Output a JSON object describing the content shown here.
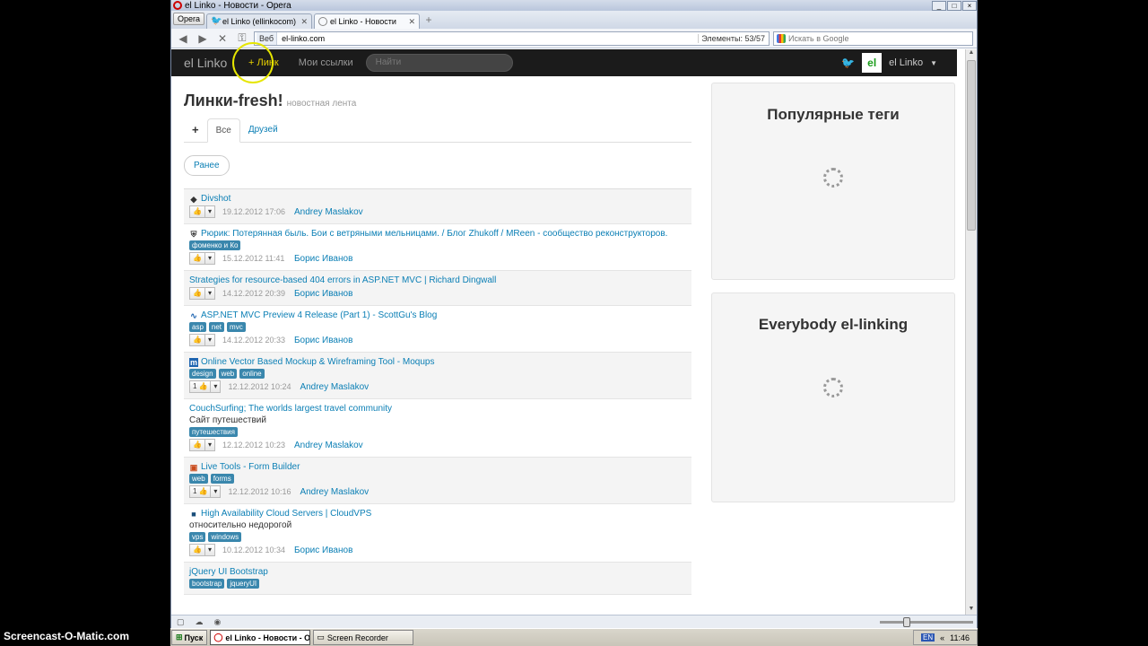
{
  "browser": {
    "window_title": "el Linko - Новости - Opera",
    "menu_label": "Opera",
    "tabs": [
      {
        "label": "el Linko (ellinkocom) в Tw...",
        "icon": "twitter-bird-icon",
        "active": false
      },
      {
        "label": "el Linko - Новости",
        "icon": "loading-icon",
        "active": true
      }
    ],
    "web_label": "Веб",
    "url": "el-linko.com",
    "elements_label": "Элементы:",
    "elements_count": "53/57",
    "search_placeholder": "Искать в Google"
  },
  "site": {
    "brand": "el Linko",
    "add_link": "+ Линк",
    "my_links": "Мои ссылки",
    "search_placeholder": "Найти",
    "avatar_text": "el",
    "username": "el Linko"
  },
  "page": {
    "title": "Линки-fresh!",
    "subtitle": "новостная лента",
    "tabs": {
      "plus": "+",
      "all": "Все",
      "friends": "Друзей"
    },
    "earlier": "Ранее"
  },
  "feed": [
    {
      "icon": "divshot-icon",
      "title": "Divshot",
      "desc": "",
      "tags": [],
      "count": "",
      "date": "19.12.2012 17:06",
      "author": "Andrey Maslakov"
    },
    {
      "icon": "shield-icon",
      "title": "Рюрик: Потерянная быль. Бои с ветряными мельницами. / Блог Zhukoff / MReen - сообщество реконструкторов.",
      "desc": "",
      "tags": [
        "фоменко и Ко"
      ],
      "count": "",
      "date": "15.12.2012 11:41",
      "author": "Борис Иванов"
    },
    {
      "icon": "",
      "title": "Strategies for resource-based 404 errors in ASP.NET MVC | Richard Dingwall",
      "desc": "",
      "tags": [],
      "count": "",
      "date": "14.12.2012 20:39",
      "author": "Борис Иванов"
    },
    {
      "icon": "scottgu-icon",
      "title": "ASP.NET MVC Preview 4 Release (Part 1) - ScottGu's Blog",
      "desc": "",
      "tags": [
        "asp",
        "net",
        "mvc"
      ],
      "count": "",
      "date": "14.12.2012 20:33",
      "author": "Борис Иванов"
    },
    {
      "icon": "moqups-icon",
      "title": "Online Vector Based Mockup & Wireframing Tool - Moqups",
      "desc": "",
      "tags": [
        "design",
        "web",
        "online"
      ],
      "count": "1",
      "date": "12.12.2012 10:24",
      "author": "Andrey Maslakov"
    },
    {
      "icon": "",
      "title": "CouchSurfing; The worlds largest travel community",
      "desc": "Сайт путешествий",
      "tags": [
        "путешествия"
      ],
      "count": "",
      "date": "12.12.2012 10:23",
      "author": "Andrey Maslakov"
    },
    {
      "icon": "toolbox-icon",
      "title": "Live Tools - Form Builder",
      "desc": "",
      "tags": [
        "web",
        "forms"
      ],
      "count": "1",
      "date": "12.12.2012 10:16",
      "author": "Andrey Maslakov"
    },
    {
      "icon": "cloud-server-icon",
      "title": "High Availability Cloud Servers | CloudVPS",
      "desc": "относительно недорогой",
      "tags": [
        "vps",
        "windows"
      ],
      "count": "",
      "date": "10.12.2012 10:34",
      "author": "Борис Иванов"
    },
    {
      "icon": "",
      "title": "jQuery UI Bootstrap",
      "desc": "",
      "tags": [
        "bootstrap",
        "jqueryUI"
      ],
      "count": "",
      "date": "",
      "author": ""
    }
  ],
  "sidebar": {
    "popular_tags": "Популярные теги",
    "everybody": "Everybody el-linking"
  },
  "taskbar": {
    "start": "Пуск",
    "tasks": [
      "el Linko - Новости - O...",
      "Screen Recorder"
    ],
    "lang": "EN",
    "time": "11:46"
  },
  "watermark": "Screencast-O-Matic.com",
  "colors": {
    "link": "#0b7fb5",
    "tag": "#3a87ad",
    "navbar": "#1b1b1b",
    "highlight": "#e8d100"
  }
}
